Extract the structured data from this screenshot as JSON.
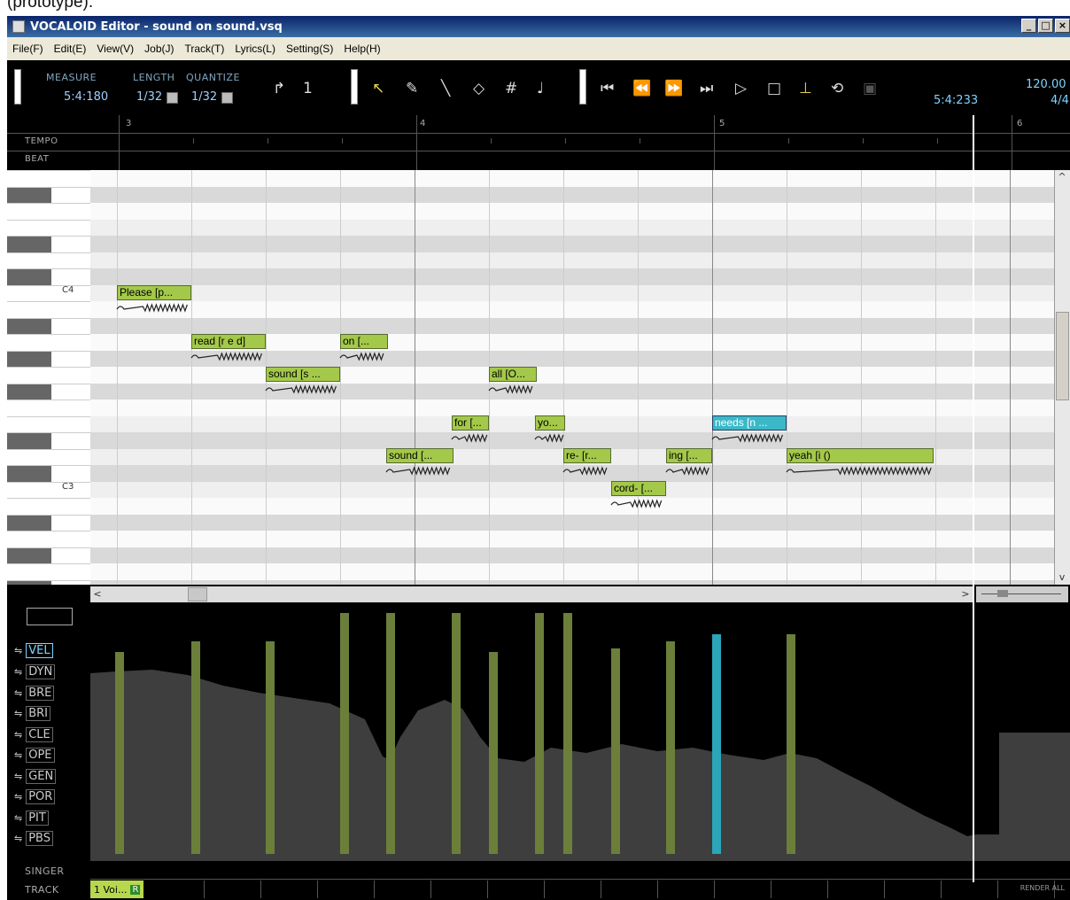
{
  "caption": "(prototype).",
  "window": {
    "title": "VOCALOID Editor - sound on sound.vsq",
    "min": "_",
    "max": "□",
    "close": "×"
  },
  "menu": [
    "File(F)",
    "Edit(E)",
    "View(V)",
    "Job(J)",
    "Track(T)",
    "Lyrics(L)",
    "Setting(S)",
    "Help(H)"
  ],
  "toolbar": {
    "measure_label": "MEASURE",
    "measure_value": "5:4:180",
    "length_label": "LENGTH",
    "length_value": "1/32",
    "quantize_label": "QUANTIZE",
    "quantize_value": "1/32",
    "position": "5:4:233",
    "tempo": "120.00",
    "beat": "4/4",
    "icons": [
      "pointer-length-icon",
      "length-one-icon",
      "arrow-select-icon",
      "pencil-icon",
      "line-icon",
      "eraser-icon",
      "grid-icon",
      "note-icon",
      "rewind-start-icon",
      "rewind-icon",
      "forward-icon",
      "forward-end-icon",
      "play-icon",
      "stop-icon",
      "auto-scroll-icon",
      "loop-icon",
      "rex-icon"
    ]
  },
  "ruler": {
    "tempo_label": "TEMPO",
    "beat_label": "BEAT",
    "bars": [
      "3",
      "4",
      "5",
      "6"
    ]
  },
  "keys": {
    "c4": "C4",
    "c3": "C3"
  },
  "notes": [
    {
      "lyric": "Please [p...",
      "selected": false
    },
    {
      "lyric": "read [r e d]",
      "selected": false
    },
    {
      "lyric": "sound [s ...",
      "selected": false
    },
    {
      "lyric": "on [...",
      "selected": false
    },
    {
      "lyric": "sound [...",
      "selected": false
    },
    {
      "lyric": "for [...",
      "selected": false
    },
    {
      "lyric": "all [O...",
      "selected": false
    },
    {
      "lyric": "yo...",
      "selected": false
    },
    {
      "lyric": "re- [r...",
      "selected": false
    },
    {
      "lyric": "cord- [...",
      "selected": false
    },
    {
      "lyric": "ing [...",
      "selected": false
    },
    {
      "lyric": "needs [n ...",
      "selected": true
    },
    {
      "lyric": "yeah [i ()",
      "selected": false
    }
  ],
  "controls": [
    "VEL",
    "DYN",
    "BRE",
    "BRI",
    "CLE",
    "OPE",
    "GEN",
    "POR",
    "PIT",
    "PBS"
  ],
  "bottom": {
    "singer_label": "SINGER",
    "track_label": "TRACK",
    "track_name": "1 Voi...",
    "track_badge": "R",
    "render_all": "RENDER ALL"
  }
}
